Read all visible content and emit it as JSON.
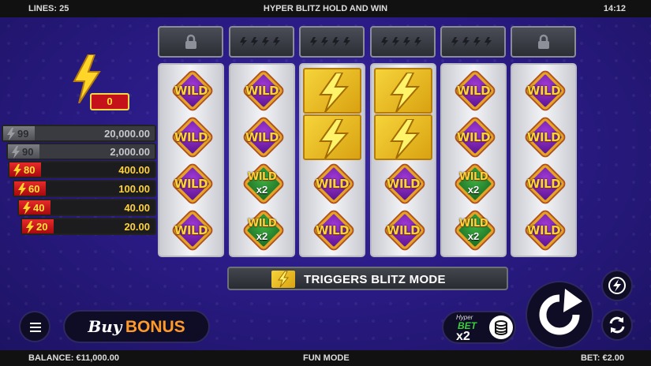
{
  "header": {
    "lines": "LINES: 25",
    "title": "HYPER BLITZ HOLD AND WIN",
    "time": "14:12"
  },
  "footer": {
    "balance": "BALANCE: €11,000.00",
    "mode": "FUN MODE",
    "bet": "BET: €2.00"
  },
  "blitz_counter": "0",
  "paytable": [
    {
      "count": "99",
      "value": "20,000.00",
      "active": false
    },
    {
      "count": "90",
      "value": "2,000.00",
      "active": false
    },
    {
      "count": "80",
      "value": "400.00",
      "active": true
    },
    {
      "count": "60",
      "value": "100.00",
      "active": true
    },
    {
      "count": "40",
      "value": "40.00",
      "active": true
    },
    {
      "count": "20",
      "value": "20.00",
      "active": true
    }
  ],
  "lock_row": [
    "locked",
    "bolts",
    "bolts",
    "bolts",
    "bolts",
    "locked"
  ],
  "reels": [
    [
      "WILD",
      "WILD",
      "WILD",
      "WILD"
    ],
    [
      "WILD",
      "WILD",
      "WILD x2",
      "WILD x2"
    ],
    [
      "BOLT",
      "BOLT",
      "WILD",
      "WILD"
    ],
    [
      "BOLT",
      "BOLT",
      "WILD",
      "WILD"
    ],
    [
      "WILD",
      "WILD",
      "WILD x2",
      "WILD x2"
    ],
    [
      "WILD",
      "WILD",
      "WILD",
      "WILD"
    ]
  ],
  "symbol_text": {
    "wild": "WILD",
    "multiplier": "x2"
  },
  "trigger_text": "TRIGGERS BLITZ MODE",
  "buy_bonus": {
    "buy": "Buy",
    "bonus": "BONUS"
  },
  "hyper_bet": {
    "hyper": "Hyper",
    "bet": "BET",
    "multiplier": "x2"
  },
  "colors": {
    "background": "#2a1b86",
    "gold": "#ffd23a",
    "red": "#c5121a",
    "wild_purple": "#7a22b5",
    "wild_green": "#2a8a30"
  },
  "icons": [
    "lock-icon",
    "lightning-bolt-icon",
    "menu-icon",
    "spin-icon",
    "turbo-icon",
    "autoplay-icon",
    "coin-stack-icon"
  ]
}
